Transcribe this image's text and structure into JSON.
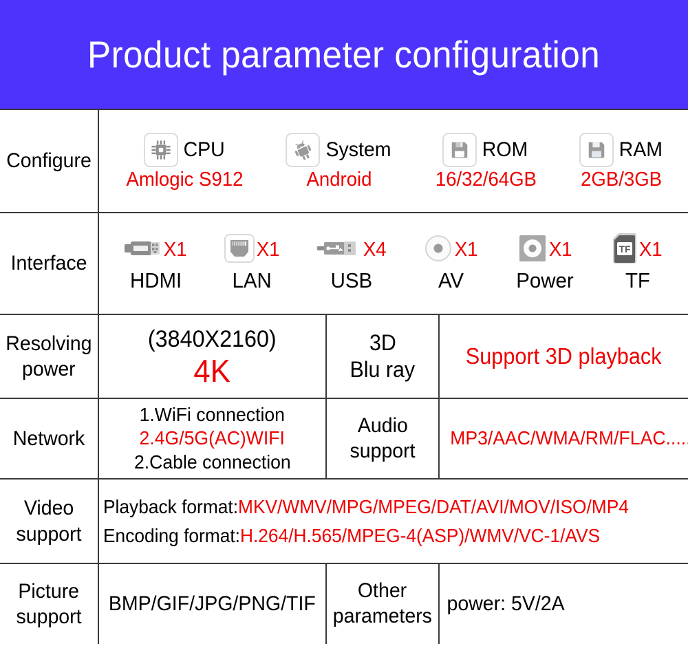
{
  "banner": {
    "title": "Product parameter configuration",
    "background": "#4d33fb",
    "text_color": "#ffffff"
  },
  "colors": {
    "accent_red": "#ee0000",
    "text_black": "#000000",
    "border": "#3a3a3a",
    "icon_gray": "#8c8c8c"
  },
  "table": {
    "rows": {
      "configure": {
        "label": "Configure",
        "items": [
          {
            "icon": "cpu-icon",
            "label": "CPU",
            "value": "Amlogic S912"
          },
          {
            "icon": "android-icon",
            "label": "System",
            "value": "Android"
          },
          {
            "icon": "floppy-icon",
            "label": "ROM",
            "value": "16/32/64GB"
          },
          {
            "icon": "floppy-icon",
            "label": "RAM",
            "value": "2GB/3GB"
          }
        ]
      },
      "interface": {
        "label": "Interface",
        "items": [
          {
            "icon": "hdmi-port-icon",
            "qty": "X1",
            "name": "HDMI"
          },
          {
            "icon": "lan-port-icon",
            "qty": "X1",
            "name": "LAN"
          },
          {
            "icon": "usb-port-icon",
            "qty": "X4",
            "name": "USB"
          },
          {
            "icon": "av-jack-icon",
            "qty": "X1",
            "name": "AV"
          },
          {
            "icon": "power-jack-icon",
            "qty": "X1",
            "name": "Power"
          },
          {
            "icon": "tf-card-icon",
            "qty": "X1",
            "name": "TF"
          }
        ]
      },
      "resolving": {
        "label": "Resolving power",
        "label_line1": "Resolving",
        "label_line2": "power",
        "resolution": "(3840X2160)",
        "resolution_short": "4K",
        "threed_line1": "3D",
        "threed_line2": "Blu ray",
        "threed_support": "Support 3D playback"
      },
      "network": {
        "label": "Network",
        "line1": "1.WiFi connection",
        "line2": "2.4G/5G(AC)WIFI",
        "line3": "2.Cable connection",
        "audio_label_line1": "Audio",
        "audio_label_line2": "support",
        "audio_formats": "MP3/AAC/WMA/RM/FLAC....."
      },
      "video": {
        "label": "Video support",
        "label_line1": "Video",
        "label_line2": "support",
        "playback_prefix": "Playback format:",
        "playback_value": "MKV/WMV/MPG/MPEG/DAT/AVI/MOV/ISO/MP4",
        "encoding_prefix": "Encoding format:",
        "encoding_value": "H.264/H.565/MPEG-4(ASP)/WMV/VC-1/AVS"
      },
      "picture": {
        "label": "Picture support",
        "label_line1": "Picture",
        "label_line2": "support",
        "formats": "BMP/GIF/JPG/PNG/TIF",
        "other_label_line1": "Other",
        "other_label_line2": "parameters",
        "other_value": "power: 5V/2A"
      }
    }
  }
}
